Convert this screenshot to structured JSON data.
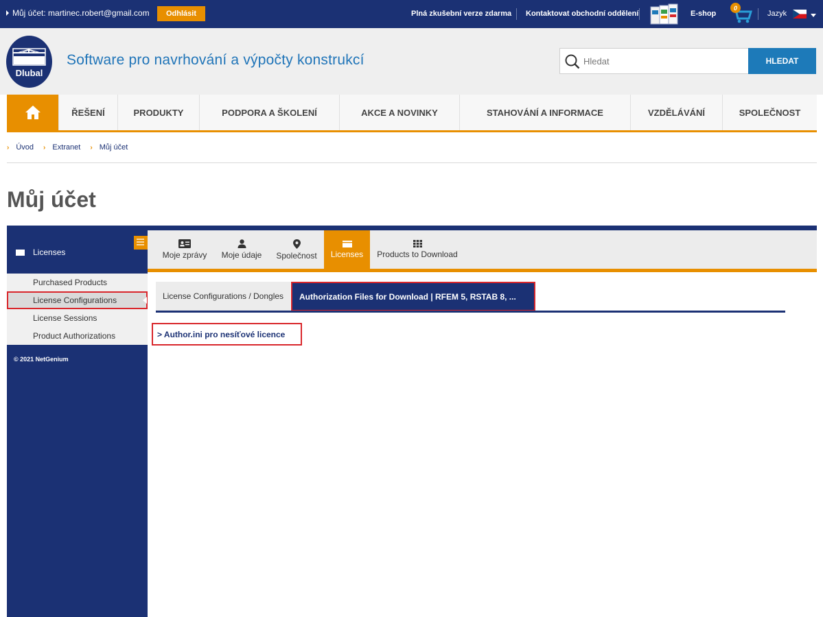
{
  "topbar": {
    "account_label": "Můj účet: martinec.robert@gmail.com",
    "logout_label": "Odhlásit",
    "trial_link": "Plná zkušební verze zdarma",
    "contact_link": "Kontaktovat obchodní oddělení",
    "eshop_link": "E-shop",
    "cart_count": "0",
    "language_label": "Jazyk"
  },
  "header": {
    "logo_text": "Dlubal",
    "tagline": "Software pro navrhování a výpočty konstrukcí",
    "search_placeholder": "Hledat",
    "search_button": "HLEDAT"
  },
  "nav": {
    "items": [
      "ŘEŠENÍ",
      "PRODUKTY",
      "PODPORA A ŠKOLENÍ",
      "AKCE A NOVINKY",
      "STAHOVÁNÍ A INFORMACE",
      "VZDĚLÁVÁNÍ",
      "SPOLEČNOST"
    ]
  },
  "breadcrumb": [
    "Úvod",
    "Extranet",
    "Můj účet"
  ],
  "page_title": "Můj účet",
  "sidebar": {
    "heading": "Licenses",
    "items": [
      "Purchased Products",
      "License Configurations",
      "License Sessions",
      "Product Authorizations"
    ],
    "active_item": "License Configurations",
    "copyright": "© 2021 NetGenium"
  },
  "tabs": [
    {
      "label": "Moje zprávy",
      "icon": "id-card-icon"
    },
    {
      "label": "Moje údaje",
      "icon": "person-icon"
    },
    {
      "label": "Společnost",
      "icon": "map-pin-icon"
    },
    {
      "label": "Licenses",
      "icon": "licenses-icon"
    },
    {
      "label": "Products to Download",
      "icon": "grid-icon"
    }
  ],
  "active_tab": "Licenses",
  "subtabs": {
    "configs": "License Configurations / Dongles",
    "authorization": "Authorization Files for Download | RFEM 5, RSTAB 8, ..."
  },
  "content": {
    "link": "> Author.ini pro nesíťové licence"
  },
  "colors": {
    "navy": "#1b3174",
    "orange": "#e88f00",
    "blue": "#1d7ab9",
    "highlight_red": "#d9262b"
  }
}
